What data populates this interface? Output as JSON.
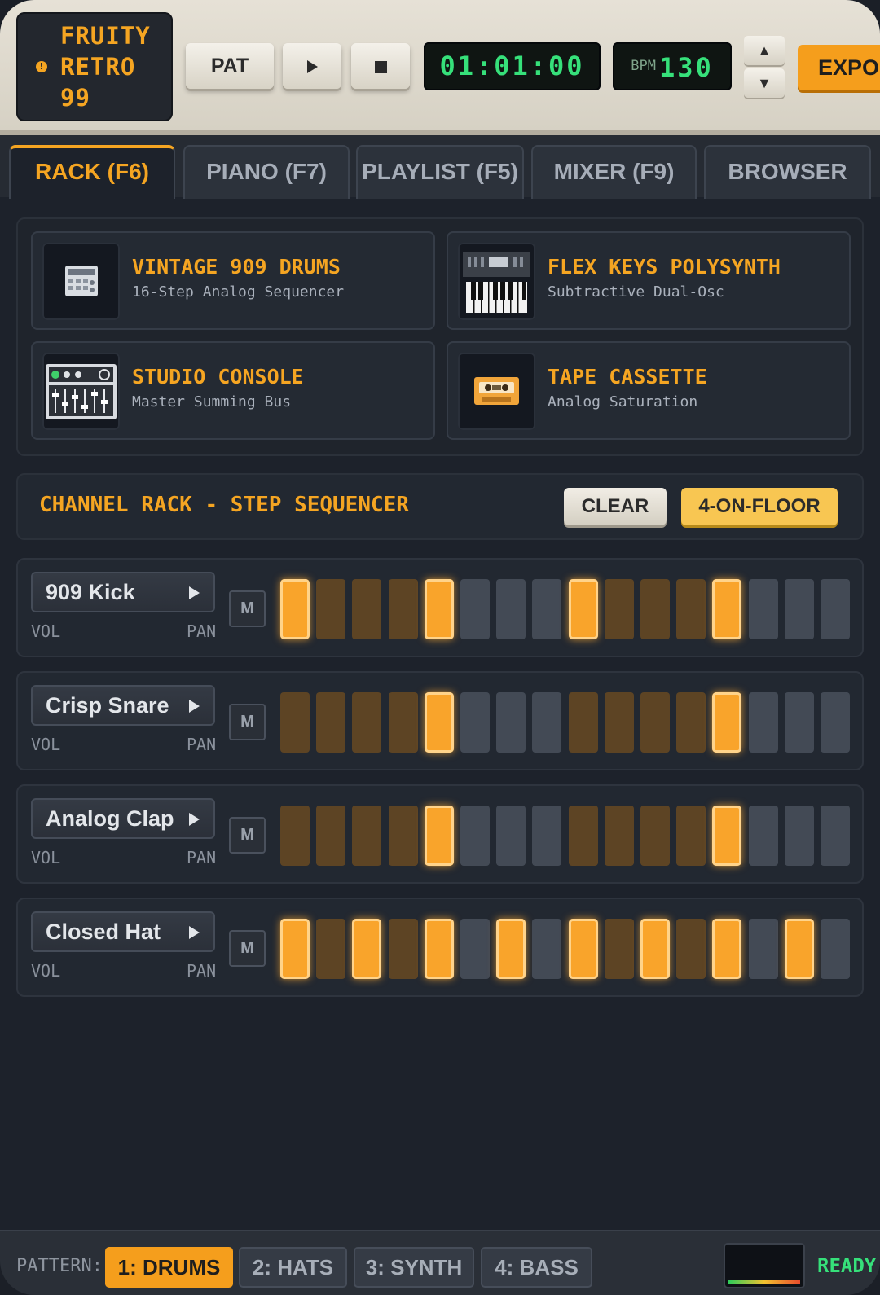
{
  "app": {
    "logo_lines": [
      "FRUITY",
      "RETRO",
      "99"
    ],
    "accent_color": "#f5a522"
  },
  "transport": {
    "pat_label": "PAT",
    "play_icon": "play-icon",
    "stop_icon": "stop-icon",
    "time": "01:01:00",
    "bpm_label": "BPM",
    "bpm_value": "130",
    "up_glyph": "▲",
    "down_glyph": "▼",
    "export_label": "EXPO"
  },
  "tabs": [
    {
      "label": "RACK (F6)",
      "active": true
    },
    {
      "label": "PIANO (F7)",
      "active": false
    },
    {
      "label": "PLAYLIST (F5)",
      "active": false
    },
    {
      "label": "MIXER (F9)",
      "active": false
    },
    {
      "label": "BROWSER",
      "active": false
    }
  ],
  "plugins": [
    {
      "name": "VINTAGE 909 DRUMS",
      "desc": "16-Step Analog Sequencer",
      "icon": "drum-machine-icon"
    },
    {
      "name": "FLEX KEYS POLYSYNTH",
      "desc": "Subtractive Dual-Osc",
      "icon": "synth-keyboard-icon"
    },
    {
      "name": "STUDIO CONSOLE",
      "desc": "Master Summing Bus",
      "icon": "mixing-console-icon"
    },
    {
      "name": "TAPE CASSETTE",
      "desc": "Analog Saturation",
      "icon": "cassette-icon"
    }
  ],
  "sequencer": {
    "title": "CHANNEL RACK - STEP SEQUENCER",
    "clear_label": "CLEAR",
    "preset_label": "4-ON-FLOOR",
    "vol_label": "VOL",
    "pan_label": "PAN",
    "mute_label": "M",
    "channels": [
      {
        "name": "909 Kick",
        "steps": [
          1,
          0,
          0,
          0,
          1,
          0,
          0,
          0,
          1,
          0,
          0,
          0,
          1,
          0,
          0,
          0
        ]
      },
      {
        "name": "Crisp Snare",
        "steps": [
          0,
          0,
          0,
          0,
          1,
          0,
          0,
          0,
          0,
          0,
          0,
          0,
          1,
          0,
          0,
          0
        ]
      },
      {
        "name": "Analog Clap",
        "steps": [
          0,
          0,
          0,
          0,
          1,
          0,
          0,
          0,
          0,
          0,
          0,
          0,
          1,
          0,
          0,
          0
        ]
      },
      {
        "name": "Closed Hat",
        "steps": [
          1,
          0,
          1,
          0,
          1,
          0,
          1,
          0,
          1,
          0,
          1,
          0,
          1,
          0,
          1,
          0
        ]
      }
    ]
  },
  "footer": {
    "pattern_label": "PATTERN:",
    "patterns": [
      {
        "label": "1: DRUMS",
        "active": true
      },
      {
        "label": "2: HATS",
        "active": false
      },
      {
        "label": "3: SYNTH",
        "active": false
      },
      {
        "label": "4: BASS",
        "active": false
      }
    ],
    "status": "READY"
  }
}
